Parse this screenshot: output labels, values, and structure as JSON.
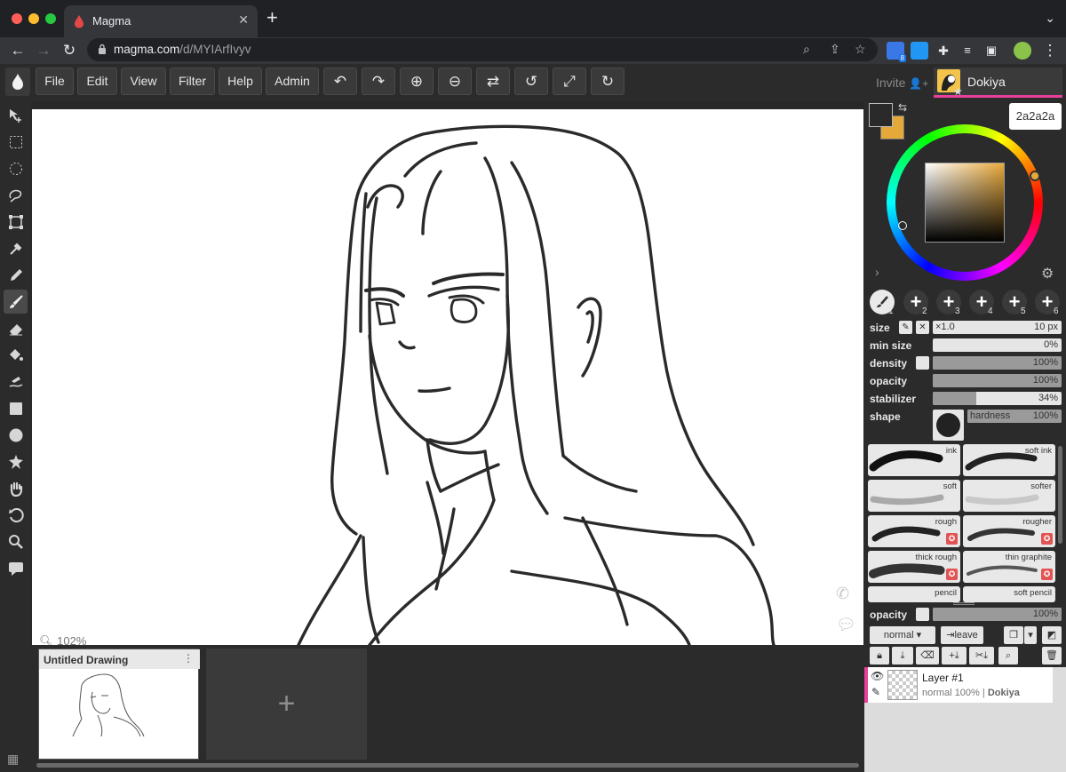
{
  "browser": {
    "tab_title": "Magma",
    "url_host": "magma.com",
    "url_path": "/d/MYIArfIvyv",
    "extension_badge": "8"
  },
  "toolbar": {
    "menus": [
      "File",
      "Edit",
      "View",
      "Filter",
      "Help",
      "Admin"
    ],
    "icon_buttons": [
      "undo-icon",
      "redo-icon",
      "zoom-in-icon",
      "zoom-out-icon",
      "flip-icon",
      "rotate-left-icon",
      "fullscreen-icon",
      "rotate-right-icon"
    ],
    "invite_label": "Invite",
    "username": "Dokiya",
    "accent_color": "#e8409a"
  },
  "tools": [
    "move-icon",
    "rect-select-icon",
    "ellipse-select-icon",
    "lasso-icon",
    "transform-icon",
    "eyedropper-icon",
    "pencil-icon",
    "brush-icon",
    "eraser-icon",
    "fill-icon",
    "smudge-icon",
    "rectangle-icon",
    "ellipse-icon",
    "shape-icon",
    "hand-icon",
    "rotate-view-icon",
    "zoom-icon",
    "chat-icon"
  ],
  "canvas": {
    "zoom_label": "102%"
  },
  "drawings": {
    "current_title": "Untitled Drawing",
    "add_label": "+"
  },
  "color": {
    "primary": "#2a2a2a",
    "secondary": "#e5a93a",
    "hex_display": "2a2a2a"
  },
  "brush_slots": [
    "1",
    "2",
    "3",
    "4",
    "5",
    "6"
  ],
  "brush_settings": {
    "size_label": "size",
    "size_multiplier": "×1.0",
    "size_value": "10 px",
    "min_size_label": "min size",
    "min_size_value": "0%",
    "min_size_fraction": 0,
    "density_label": "density",
    "density_value": "100%",
    "density_fraction": 1,
    "opacity_label": "opacity",
    "opacity_value": "100%",
    "opacity_fraction": 1,
    "stabilizer_label": "stabilizer",
    "stabilizer_value": "34%",
    "stabilizer_fraction": 0.34,
    "shape_label": "shape",
    "hardness_label": "hardness",
    "hardness_value": "100%"
  },
  "brushes": [
    {
      "name": "ink",
      "premium": false
    },
    {
      "name": "soft ink",
      "premium": false
    },
    {
      "name": "soft",
      "premium": false
    },
    {
      "name": "softer",
      "premium": false
    },
    {
      "name": "rough",
      "premium": true
    },
    {
      "name": "rougher",
      "premium": true
    },
    {
      "name": "thick rough",
      "premium": true
    },
    {
      "name": "thin graphite",
      "premium": true
    },
    {
      "name": "pencil",
      "premium": false
    },
    {
      "name": "soft pencil",
      "premium": false
    }
  ],
  "layers_panel": {
    "opacity_label": "opacity",
    "opacity_value": "100%",
    "blend_mode": "normal",
    "leave_label": "leave",
    "layer_name": "Layer #1",
    "layer_mode": "normal",
    "layer_opacity": "100%",
    "layer_owner": "Dokiya"
  }
}
